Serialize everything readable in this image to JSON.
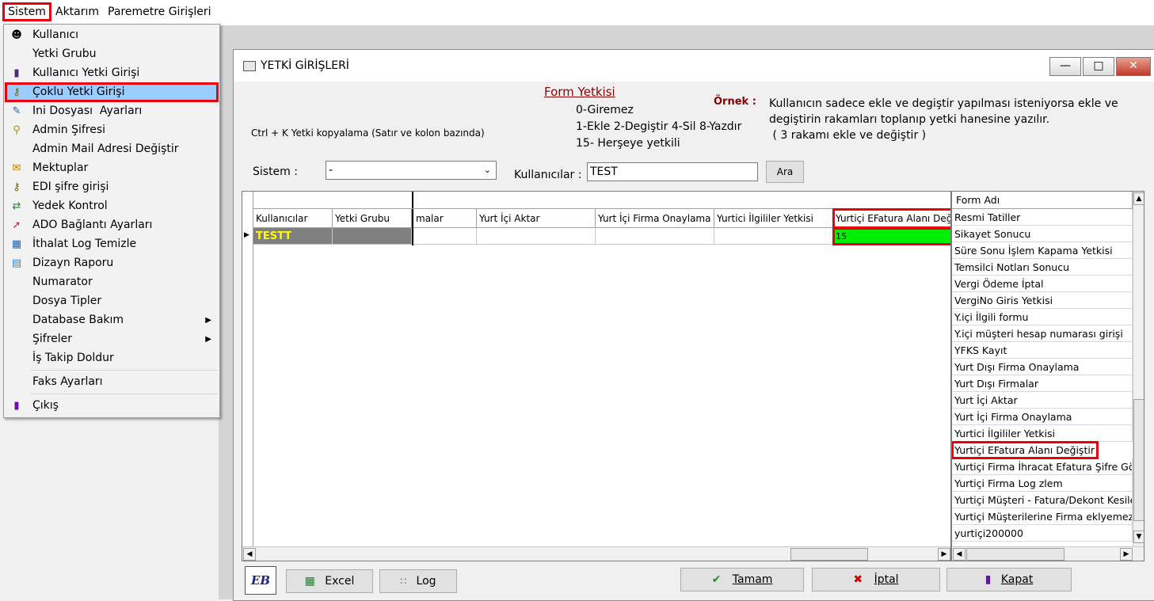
{
  "menubar": {
    "items": [
      "Sistem",
      "Aktarım",
      "Paremetre Girişleri"
    ]
  },
  "dropdown": {
    "items": [
      {
        "label": "Kullanıcı",
        "icon": "user-icon"
      },
      {
        "label": "Yetki Grubu",
        "icon": ""
      },
      {
        "label": "Kullanıcı Yetki Girişi",
        "icon": "user-pen-icon"
      },
      {
        "label": "Çoklu Yetki Girişi",
        "icon": "keys-icon"
      },
      {
        "label": "Ini Dosyası  Ayarları",
        "icon": "edit-file-icon"
      },
      {
        "label": "Admin Şifresi",
        "icon": "key-icon"
      },
      {
        "label": "Admin Mail Adresi Değiştir",
        "icon": ""
      },
      {
        "label": "Mektuplar",
        "icon": "letter-icon"
      },
      {
        "label": "EDI şifre girişi",
        "icon": "keys-icon"
      },
      {
        "label": "Yedek Kontrol",
        "icon": "backup-icon"
      },
      {
        "label": "ADO Bağlantı Ayarları",
        "icon": "connection-icon"
      },
      {
        "label": "İthalat Log Temizle",
        "icon": "clean-icon"
      },
      {
        "label": "Dizayn Raporu",
        "icon": "report-icon"
      },
      {
        "label": "Numarator",
        "icon": ""
      },
      {
        "label": "Dosya Tipler",
        "icon": ""
      },
      {
        "label": "Database Bakım",
        "icon": ""
      },
      {
        "label": "Şifreler",
        "icon": ""
      },
      {
        "label": "İş Takip Doldur",
        "icon": ""
      },
      {
        "label": "Faks Ayarları",
        "icon": ""
      },
      {
        "label": "Çıkış",
        "icon": "exit-icon"
      }
    ]
  },
  "window": {
    "title": "YETKİ GİRİŞLERİ",
    "form_yetkisi": "Form Yetkisi",
    "codes": [
      "0-Giremez",
      "1-Ekle  2-Degiştir  4-Sil  8-Yazdır",
      "15- Herşeye yetkili"
    ],
    "ornek_label": "Örnek :",
    "ornek_text": [
      "Kullanıcın sadece ekle ve degiştir yapılması isteniyorsa  ekle ve",
      "degiştirin rakamları toplanıp yetki hanesine yazılır.",
      " ( 3 rakamı ekle ve değiştir )"
    ],
    "copy_hint": "Ctrl + K Yetki kopyalama (Satır ve kolon bazında)",
    "sistem_label": "Sistem :",
    "sistem_value": "-",
    "kullanicilar_label": "Kullanıcılar :",
    "kullanicilar_value": "TEST",
    "ara_label": "Ara"
  },
  "grid": {
    "columns": [
      "Kullanıcılar",
      "Yetki Grubu",
      "malar",
      "Yurt İçi Aktar",
      "Yurt İçi Firma Onaylama",
      "Yurtici İlgililer Yetkisi",
      "Yurtiçi EFatura Alanı Değ"
    ],
    "row": {
      "user": "TESTT",
      "group": "",
      "efatura": "15"
    }
  },
  "list": {
    "header": "Form Adı",
    "items": [
      "Resmi Tatiller",
      "Sikayet Sonucu",
      "Süre Sonu İşlem Kapama Yetkisi",
      "Temsilci Notları Sonucu",
      "Vergi Ödeme İptal",
      "VergiNo Giris Yetkisi",
      "Y.içi İlgili formu",
      "Y.içi müşteri hesap numarası girişi",
      "YFKS Kayıt",
      "Yurt Dışı Firma Onaylama",
      "Yurt Dışı Firmalar",
      "Yurt İçi Aktar",
      "Yurt İçi Firma Onaylama",
      "Yurtici İlgililer Yetkisi",
      "Yurtiçi EFatura Alanı Değiştir",
      "Yurtiçi Firma İhracat Efatura Şifre Göste",
      "Yurtiçi Firma Log zlem",
      "Yurtiçi Müşteri - Fatura/Dekont Kesilebil",
      "Yurtiçi Müşterilerine Firma eklyemez",
      "yurtiçi200000"
    ]
  },
  "buttons": {
    "logo": "EB",
    "excel": "Excel",
    "log": "Log",
    "tamam": "Tamam",
    "iptal": "İptal",
    "kapat": "Kapat"
  },
  "colors": {
    "highlight_red": "#e8000f",
    "selected_menu": "#99ccff",
    "green_cell": "#00ee00",
    "title_red": "#8b0000"
  }
}
